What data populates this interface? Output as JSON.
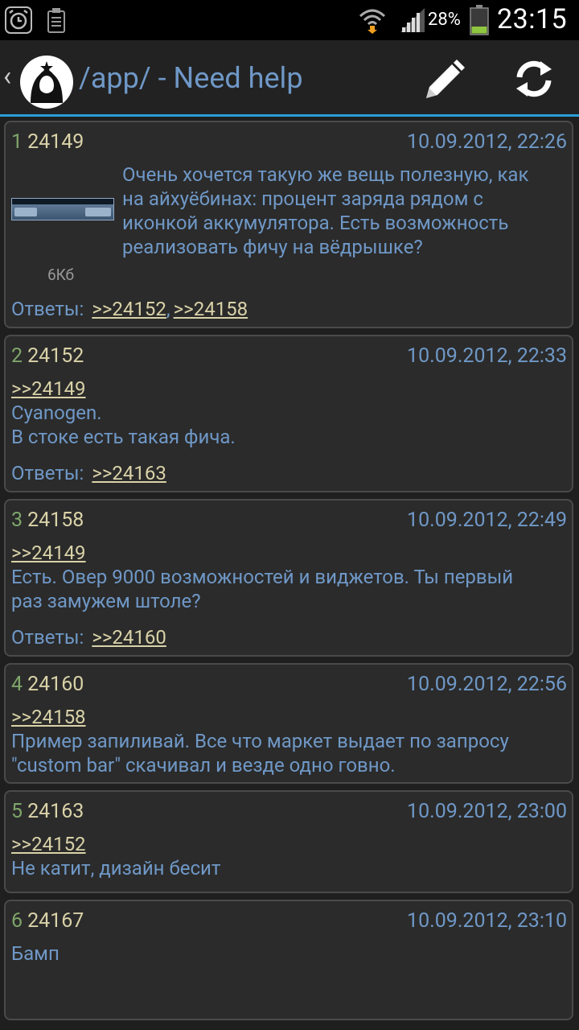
{
  "status_bar": {
    "battery_percent": "28%",
    "time": "23:15",
    "icons": [
      "alarm-icon",
      "clipboard-icon",
      "wifi-icon",
      "signal-icon",
      "battery-icon"
    ]
  },
  "action_bar": {
    "back": "‹",
    "board": "/app/",
    "separator": "-",
    "thread_title": "Need help",
    "icons": [
      "anonymous-logo",
      "edit-icon",
      "refresh-icon"
    ]
  },
  "labels": {
    "answers": "Ответы:"
  },
  "posts": [
    {
      "index": "1",
      "number": "24149",
      "date": "10.09.2012, 22:26",
      "lines": [
        "Очень хочется такую же вещь полезную, как",
        "на айхуёбинах: процент заряда рядом с",
        "иконкой аккумулятора. Есть возможность",
        "реализовать фичу на вёдрышке?"
      ],
      "attachment_size": "6Кб",
      "answers": [
        ">>24152",
        ">>24158"
      ]
    },
    {
      "index": "2",
      "number": "24152",
      "date": "10.09.2012, 22:33",
      "quote": ">>24149",
      "lines": [
        "Cyanogen.",
        "В стоке есть такая фича."
      ],
      "answers": [
        ">>24163"
      ]
    },
    {
      "index": "3",
      "number": "24158",
      "date": "10.09.2012, 22:49",
      "quote": ">>24149",
      "lines": [
        "Есть. Овер 9000 возможностей и виджетов. Ты первый",
        "раз замужем штоле?"
      ],
      "answers": [
        ">>24160"
      ]
    },
    {
      "index": "4",
      "number": "24160",
      "date": "10.09.2012, 22:56",
      "quote": ">>24158",
      "lines": [
        "Пример запиливай. Все что маркет выдает по запросу",
        "\"custom bar\" скачивал и везде одно говно."
      ]
    },
    {
      "index": "5",
      "number": "24163",
      "date": "10.09.2012, 23:00",
      "quote": ">>24152",
      "lines": [
        "Не катит, дизайн бесит"
      ]
    },
    {
      "index": "6",
      "number": "24167",
      "date": "10.09.2012, 23:10",
      "lines": [
        "Бамп"
      ]
    }
  ]
}
